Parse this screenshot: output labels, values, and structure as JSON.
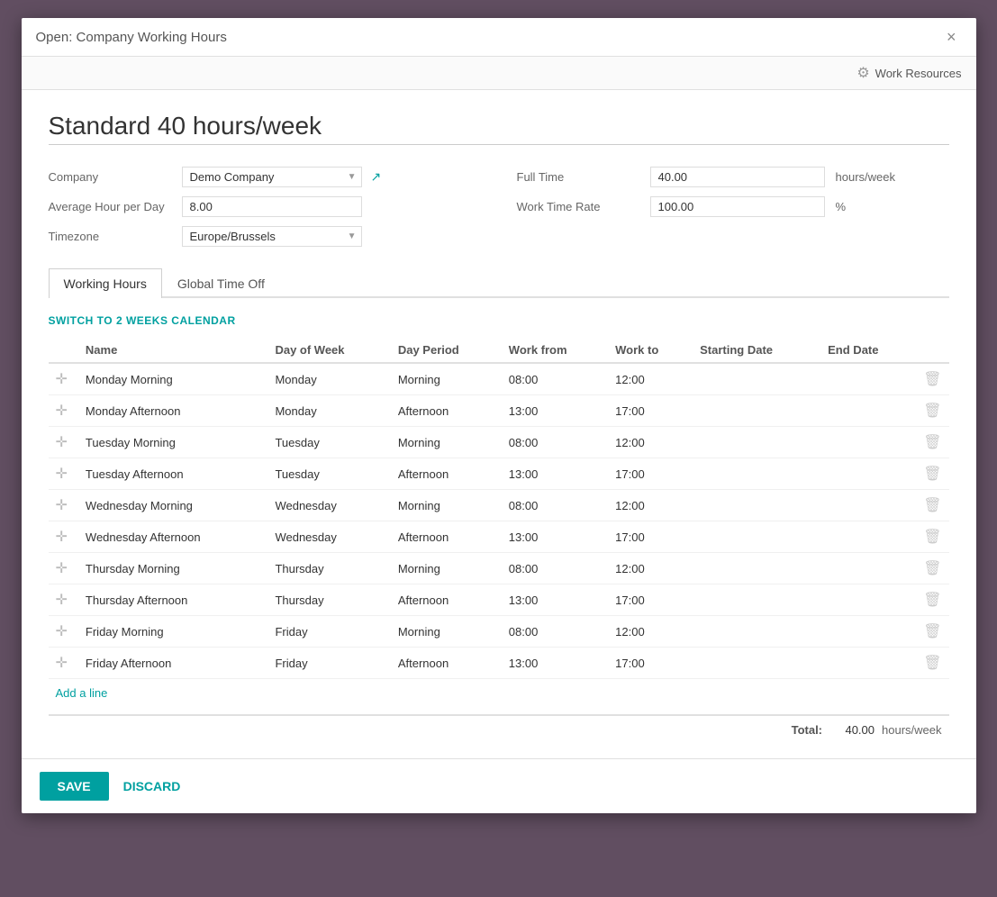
{
  "modal": {
    "title": "Open: Company Working Hours",
    "close_label": "×"
  },
  "toolbar": {
    "work_resources_label": "Work Resources",
    "gear_icon": "⚙"
  },
  "form": {
    "record_title": "Standard 40 hours/week",
    "fields": {
      "company_label": "Company",
      "company_value": "Demo Company",
      "avg_hour_label": "Average Hour per Day",
      "avg_hour_value": "8.00",
      "timezone_label": "Timezone",
      "timezone_value": "Europe/Brussels",
      "full_time_label": "Full Time",
      "full_time_value": "40.00",
      "full_time_unit": "hours/week",
      "work_time_rate_label": "Work Time Rate",
      "work_time_rate_value": "100.00",
      "work_time_rate_unit": "%"
    },
    "tabs": [
      {
        "id": "working-hours",
        "label": "Working Hours",
        "active": true
      },
      {
        "id": "global-time-off",
        "label": "Global Time Off",
        "active": false
      }
    ],
    "switch_calendar_label": "SWITCH TO 2 WEEKS CALENDAR",
    "table": {
      "columns": [
        {
          "id": "name",
          "label": "Name"
        },
        {
          "id": "day_of_week",
          "label": "Day of Week"
        },
        {
          "id": "day_period",
          "label": "Day Period"
        },
        {
          "id": "work_from",
          "label": "Work from"
        },
        {
          "id": "work_to",
          "label": "Work to"
        },
        {
          "id": "starting_date",
          "label": "Starting Date"
        },
        {
          "id": "end_date",
          "label": "End Date"
        }
      ],
      "rows": [
        {
          "name": "Monday Morning",
          "day_of_week": "Monday",
          "day_period": "Morning",
          "work_from": "08:00",
          "work_to": "12:00",
          "starting_date": "",
          "end_date": ""
        },
        {
          "name": "Monday Afternoon",
          "day_of_week": "Monday",
          "day_period": "Afternoon",
          "work_from": "13:00",
          "work_to": "17:00",
          "starting_date": "",
          "end_date": ""
        },
        {
          "name": "Tuesday Morning",
          "day_of_week": "Tuesday",
          "day_period": "Morning",
          "work_from": "08:00",
          "work_to": "12:00",
          "starting_date": "",
          "end_date": ""
        },
        {
          "name": "Tuesday Afternoon",
          "day_of_week": "Tuesday",
          "day_period": "Afternoon",
          "work_from": "13:00",
          "work_to": "17:00",
          "starting_date": "",
          "end_date": ""
        },
        {
          "name": "Wednesday Morning",
          "day_of_week": "Wednesday",
          "day_period": "Morning",
          "work_from": "08:00",
          "work_to": "12:00",
          "starting_date": "",
          "end_date": ""
        },
        {
          "name": "Wednesday Afternoon",
          "day_of_week": "Wednesday",
          "day_period": "Afternoon",
          "work_from": "13:00",
          "work_to": "17:00",
          "starting_date": "",
          "end_date": ""
        },
        {
          "name": "Thursday Morning",
          "day_of_week": "Thursday",
          "day_period": "Morning",
          "work_from": "08:00",
          "work_to": "12:00",
          "starting_date": "",
          "end_date": ""
        },
        {
          "name": "Thursday Afternoon",
          "day_of_week": "Thursday",
          "day_period": "Afternoon",
          "work_from": "13:00",
          "work_to": "17:00",
          "starting_date": "",
          "end_date": ""
        },
        {
          "name": "Friday Morning",
          "day_of_week": "Friday",
          "day_period": "Morning",
          "work_from": "08:00",
          "work_to": "12:00",
          "starting_date": "",
          "end_date": ""
        },
        {
          "name": "Friday Afternoon",
          "day_of_week": "Friday",
          "day_period": "Afternoon",
          "work_from": "13:00",
          "work_to": "17:00",
          "starting_date": "",
          "end_date": ""
        }
      ],
      "add_line_label": "Add a line",
      "total_label": "Total:",
      "total_value": "40.00",
      "total_unit": "hours/week"
    }
  },
  "footer": {
    "save_label": "SAVE",
    "discard_label": "DISCARD"
  }
}
